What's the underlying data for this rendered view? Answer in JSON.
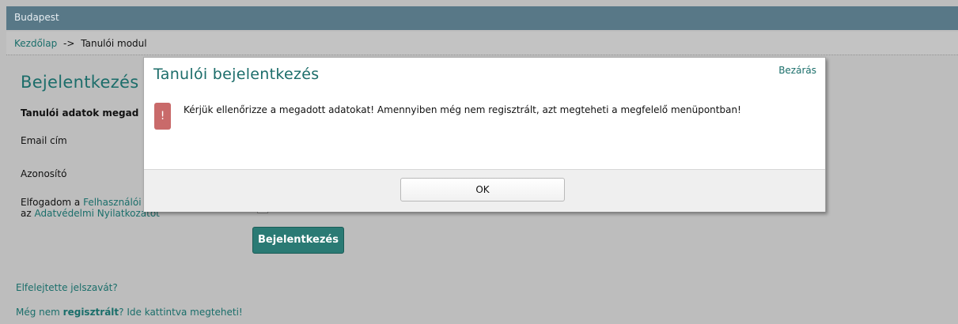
{
  "window": {
    "title": "Budapest"
  },
  "breadcrumb": {
    "home": "Kezdőlap",
    "separator": "->",
    "current": "Tanulói modul"
  },
  "page": {
    "title": "Bejelentkezés",
    "section_heading": "Tanulói adatok megad",
    "email_label": "Email cím",
    "id_label": "Azonosító",
    "accept_prefix": "Elfogadom a ",
    "accept_link1": "Felhasználói S",
    "accept_line2_prefix": "az ",
    "accept_link2": "Adatvédelmi Nyilatkozatot",
    "login_button": "Bejelentkezés",
    "forgot_link": "Elfelejtette jelszavát?",
    "register_prefix": "Még nem ",
    "register_bold": "regisztrált",
    "register_suffix": "? Ide kattintva megteheti!"
  },
  "modal": {
    "title": "Tanulói bejelentkezés",
    "close_label": "Bezárás",
    "alert_icon": "!",
    "message": "Kérjük ellenőrizze a megadott adatokat! Amennyiben még nem regisztrált, azt megteheti a megfelelő menüpontban!",
    "ok_label": "OK"
  },
  "colors": {
    "accent": "#1c6d6a",
    "topbar": "#587887",
    "alert": "#c96a6a",
    "backdrop": "#bdbdbd"
  }
}
